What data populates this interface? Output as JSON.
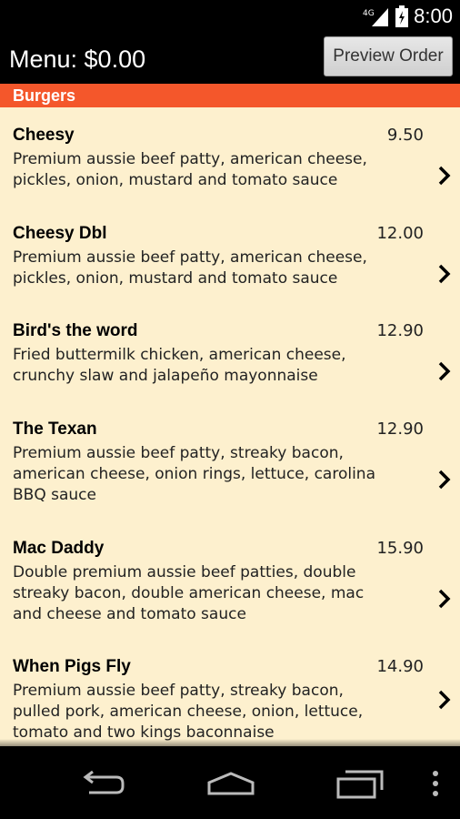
{
  "status": {
    "time": "8:00",
    "network": "4G"
  },
  "header": {
    "title": "Menu: $0.00",
    "preview_label": "Preview Order"
  },
  "section": {
    "title": "Burgers"
  },
  "items": [
    {
      "name": "Cheesy",
      "price": "9.50",
      "description": "Premium aussie beef patty, american cheese, pickles, onion, mustard and tomato sauce"
    },
    {
      "name": "Cheesy Dbl",
      "price": "12.00",
      "description": "Premium aussie beef patty, american cheese, pickles, onion, mustard and tomato sauce"
    },
    {
      "name": "Bird's the word",
      "price": "12.90",
      "description": "Fried buttermilk chicken, american cheese, crunchy slaw and jalapeño mayonnaise"
    },
    {
      "name": "The Texan",
      "price": "12.90",
      "description": "Premium aussie beef patty, streaky bacon, american cheese, onion rings, lettuce, carolina BBQ sauce"
    },
    {
      "name": "Mac Daddy",
      "price": "15.90",
      "description": "Double premium aussie beef patties, double streaky bacon, double american cheese, mac and cheese and tomato sauce"
    },
    {
      "name": "When Pigs Fly",
      "price": "14.90",
      "description": "Premium aussie beef patty, streaky bacon, pulled pork, american cheese, onion, lettuce, tomato and two kings baconnaise"
    }
  ],
  "icons": {
    "chevron": "chevron-right-icon",
    "back": "back-icon",
    "home": "home-icon",
    "recents": "recents-icon",
    "overflow": "overflow-menu-icon"
  },
  "colors": {
    "section_header": "#f4572b",
    "list_background": "#fdf0ce"
  }
}
